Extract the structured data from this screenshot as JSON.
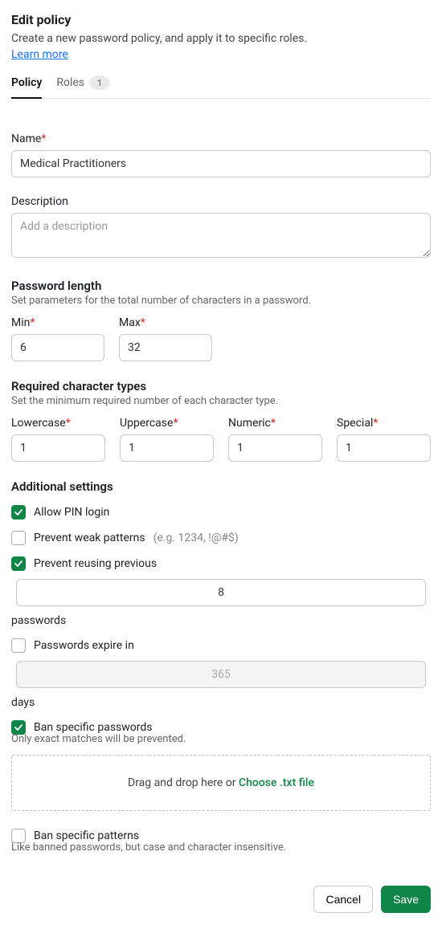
{
  "header": {
    "title": "Edit policy",
    "subtitle": "Create a new password policy, and apply it to specific roles.",
    "learn_more": "Learn more"
  },
  "tabs": {
    "policy": "Policy",
    "roles": "Roles",
    "roles_count": "1"
  },
  "name": {
    "label": "Name",
    "value": "Medical Practitioners"
  },
  "description": {
    "label": "Description",
    "placeholder": "Add a description"
  },
  "password_length": {
    "title": "Password length",
    "sub": "Set parameters for the total number of characters in a password.",
    "min_label": "Min",
    "min_value": "6",
    "max_label": "Max",
    "max_value": "32"
  },
  "char_types": {
    "title": "Required character types",
    "sub": "Set the minimum required number of each character type.",
    "lowercase_label": "Lowercase",
    "lowercase_value": "1",
    "uppercase_label": "Uppercase",
    "uppercase_value": "1",
    "numeric_label": "Numeric",
    "numeric_value": "1",
    "special_label": "Special",
    "special_value": "1"
  },
  "additional": {
    "title": "Additional settings",
    "allow_pin": "Allow PIN login",
    "prevent_weak_label": "Prevent weak patterns",
    "prevent_weak_hint": "(e.g. 1234, !@#$)",
    "prevent_reuse_pre": "Prevent reusing previous",
    "prevent_reuse_value": "8",
    "prevent_reuse_post": "passwords",
    "expire_pre": "Passwords expire in",
    "expire_value": "365",
    "expire_post": "days",
    "ban_specific": "Ban specific passwords",
    "ban_specific_hint": "Only exact matches will be prevented.",
    "dropzone_pre": "Drag and drop here ",
    "dropzone_or": "or ",
    "dropzone_choose": "Choose .txt file",
    "ban_patterns": "Ban specific patterns",
    "ban_patterns_hint": "Like banned passwords, but case and character insensitive."
  },
  "footer": {
    "cancel": "Cancel",
    "save": "Save"
  }
}
